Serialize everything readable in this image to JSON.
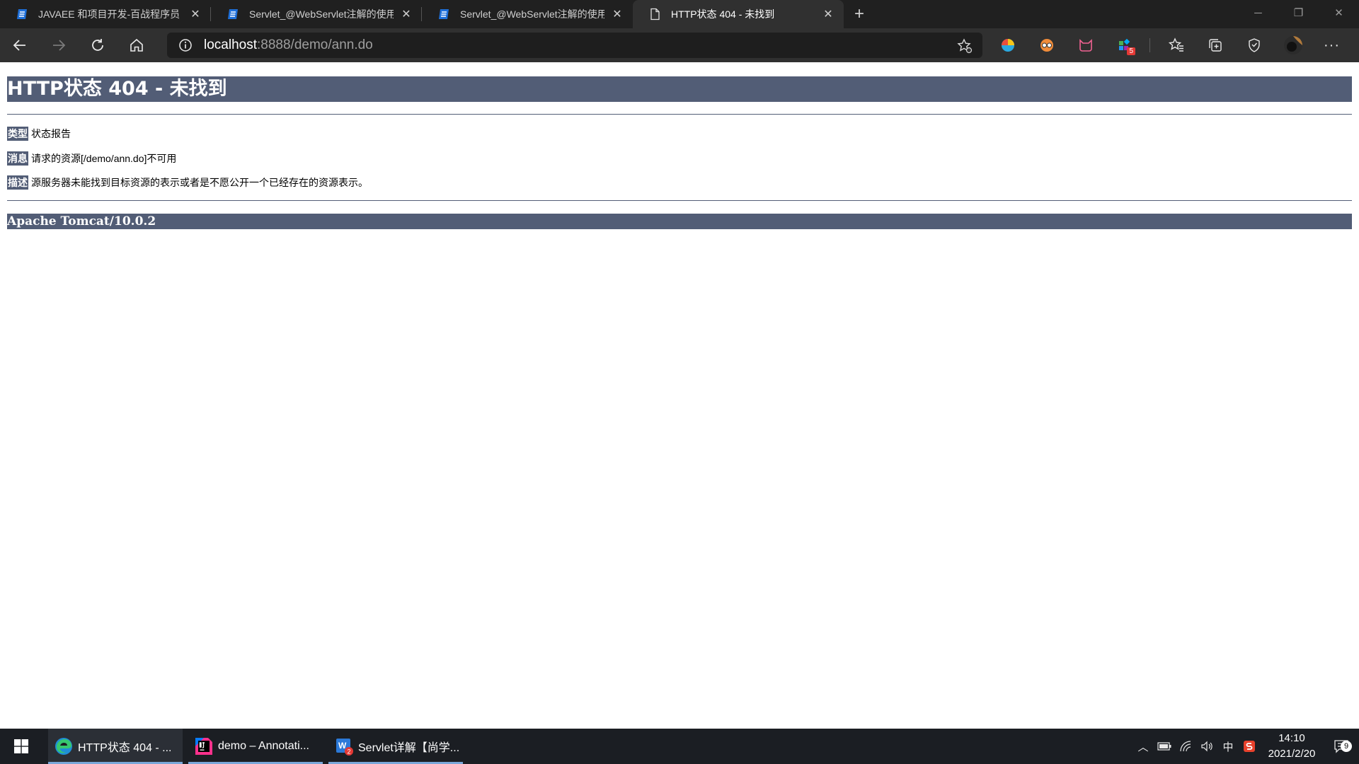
{
  "browser": {
    "tabs": [
      {
        "title": "JAVAEE 和项目开发-百战程序员",
        "icon": "blog-icon",
        "active": false
      },
      {
        "title": "Servlet_@WebServlet注解的使用",
        "icon": "blog-icon",
        "active": false
      },
      {
        "title": "Servlet_@WebServlet注解的使用",
        "icon": "blog-icon",
        "active": false
      },
      {
        "title": "HTTP状态 404 - 未找到",
        "icon": "page-icon",
        "active": true
      }
    ],
    "address": {
      "host": "localhost",
      "rest": ":8888/demo/ann.do"
    },
    "extension_badge": "5"
  },
  "page": {
    "heading": "HTTP状态 404 - 未找到",
    "type_label": "类型",
    "type_value": "状态报告",
    "message_label": "消息",
    "message_value": "请求的资源[/demo/ann.do]不可用",
    "description_label": "描述",
    "description_value": "源服务器未能找到目标资源的表示或者是不愿公开一个已经存在的资源表示。",
    "footer": "Apache Tomcat/10.0.2"
  },
  "taskbar": {
    "items": [
      {
        "label": "HTTP状态 404 - ...",
        "icon": "edge-icon"
      },
      {
        "label": "demo – Annotati...",
        "icon": "intellij-icon"
      },
      {
        "label": "Servlet详解【尚学...",
        "icon": "word-icon"
      }
    ],
    "ime": "中",
    "time": "14:10",
    "date": "2021/2/20",
    "notifications": "9"
  },
  "colors": {
    "tomcat_header": "#525d76",
    "tab_bar": "#202020",
    "toolbar": "#303030",
    "taskbar": "#1b1e23"
  }
}
